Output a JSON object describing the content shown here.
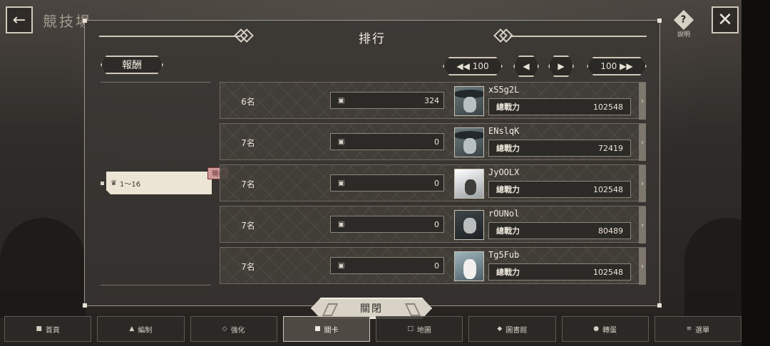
{
  "top_bar": {
    "back_icon": "arrow-left-icon",
    "screen_title": "競技場",
    "help_label": "說明",
    "close_icon": "x-icon"
  },
  "dialog": {
    "title": "排行",
    "reward_label": "報酬",
    "nav": {
      "rewind_label": "100",
      "prev_icon": "chevron-left-icon",
      "next_icon": "chevron-right-icon",
      "forward_label": "100"
    },
    "tier": {
      "range_label": "1～16",
      "current_badge": "現在"
    },
    "rows": [
      {
        "rank": "6名",
        "score": "324",
        "name": "xS5g2L",
        "power_label": "總戰力",
        "power": "102548",
        "avatar": "hat"
      },
      {
        "rank": "7名",
        "score": "0",
        "name": "ENslqK",
        "power_label": "總戰力",
        "power": "72419",
        "avatar": "hat"
      },
      {
        "rank": "7名",
        "score": "0",
        "name": "JyOOLX",
        "power_label": "總戰力",
        "power": "102548",
        "avatar": "hood"
      },
      {
        "rank": "7名",
        "score": "0",
        "name": "rOUNol",
        "power_label": "總戰力",
        "power": "80489",
        "avatar": "gun"
      },
      {
        "rank": "7名",
        "score": "0",
        "name": "Tg5Fub",
        "power_label": "總戰力",
        "power": "102548",
        "avatar": "white"
      }
    ],
    "close_label": "關閉"
  },
  "bottom_nav": [
    {
      "label": "首頁",
      "icon": "home-icon",
      "active": false
    },
    {
      "label": "編制",
      "icon": "formation-icon",
      "active": false
    },
    {
      "label": "強化",
      "icon": "enhance-icon",
      "active": false
    },
    {
      "label": "關卡",
      "icon": "lock-icon",
      "active": true
    },
    {
      "label": "地圖",
      "icon": "map-icon",
      "active": false
    },
    {
      "label": "圖書館",
      "icon": "library-icon",
      "active": false
    },
    {
      "label": "轉蛋",
      "icon": "gacha-icon",
      "active": false
    },
    {
      "label": "選單",
      "icon": "menu-icon",
      "active": false
    }
  ]
}
